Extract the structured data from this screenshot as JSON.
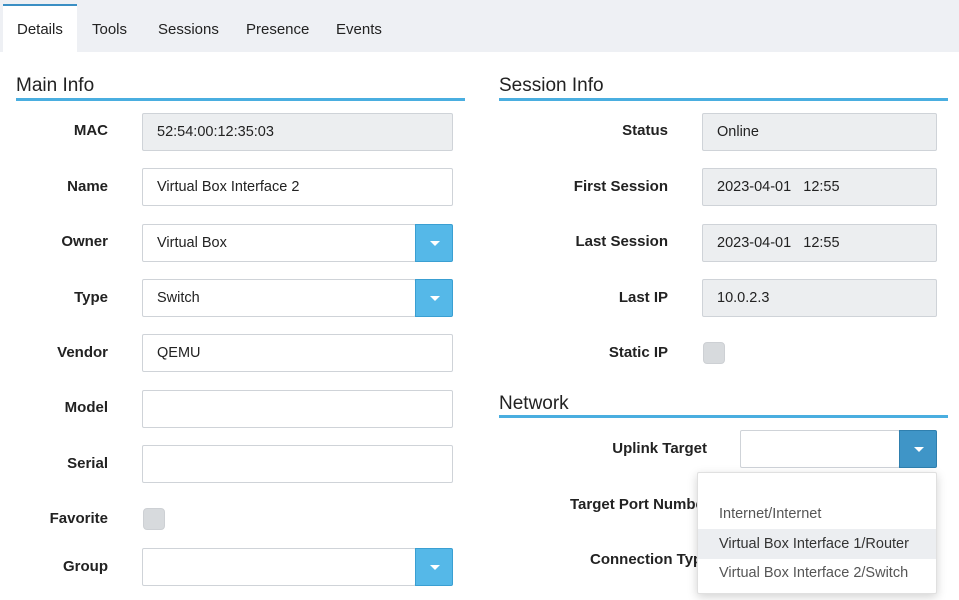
{
  "tabs": [
    {
      "label": "Details",
      "active": true
    },
    {
      "label": "Tools",
      "active": false
    },
    {
      "label": "Sessions",
      "active": false
    },
    {
      "label": "Presence",
      "active": false
    },
    {
      "label": "Events",
      "active": false
    }
  ],
  "main_info": {
    "title": "Main Info",
    "fields": {
      "mac": {
        "label": "MAC",
        "value": "52:54:00:12:35:03"
      },
      "name": {
        "label": "Name",
        "value": "Virtual Box Interface 2"
      },
      "owner": {
        "label": "Owner",
        "value": "Virtual Box"
      },
      "type": {
        "label": "Type",
        "value": "Switch"
      },
      "vendor": {
        "label": "Vendor",
        "value": "QEMU"
      },
      "model": {
        "label": "Model",
        "value": ""
      },
      "serial": {
        "label": "Serial",
        "value": ""
      },
      "favorite": {
        "label": "Favorite",
        "checked": false
      },
      "group": {
        "label": "Group",
        "value": ""
      }
    }
  },
  "session_info": {
    "title": "Session Info",
    "fields": {
      "status": {
        "label": "Status",
        "value": "Online"
      },
      "first_session": {
        "label": "First Session",
        "value": "2023-04-01   12:55"
      },
      "last_session": {
        "label": "Last Session",
        "value": "2023-04-01   12:55"
      },
      "last_ip": {
        "label": "Last IP",
        "value": "10.0.2.3"
      },
      "static_ip": {
        "label": "Static IP",
        "checked": false
      }
    }
  },
  "network": {
    "title": "Network",
    "uplink_target": {
      "label": "Uplink Target",
      "value": ""
    },
    "target_port_number": {
      "label": "Target Port Number"
    },
    "connection_type": {
      "label": "Connection Type"
    },
    "dropdown_options": [
      {
        "label": ""
      },
      {
        "label": "Internet/Internet"
      },
      {
        "label": "Virtual Box Interface 1/Router",
        "hovered": true
      },
      {
        "label": "Virtual Box Interface 2/Switch"
      }
    ]
  },
  "colors": {
    "accent_line": "#4aaee0",
    "dropdown_button": "#55b8e8",
    "dropdown_button_active": "#3f95c7",
    "readonly_bg": "#eceef0",
    "tabbar_bg": "#eef0f4"
  }
}
